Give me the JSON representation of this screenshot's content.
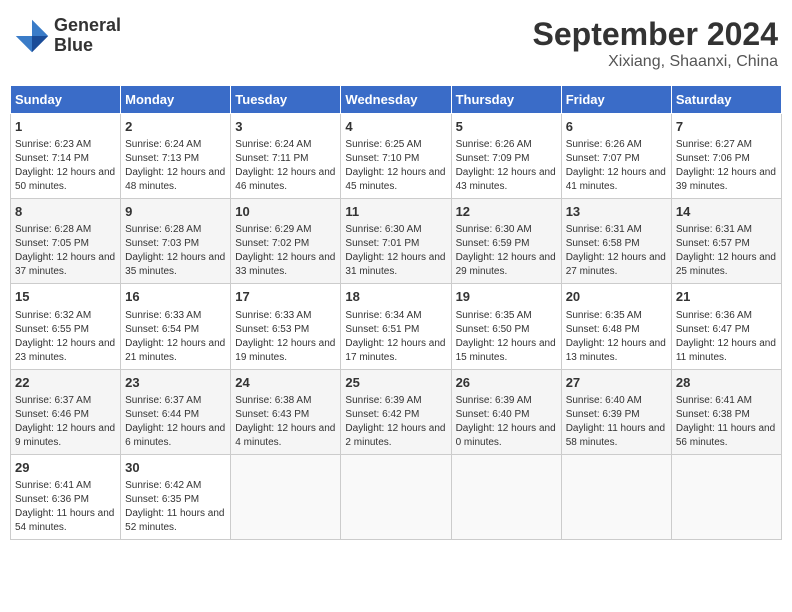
{
  "header": {
    "logo_line1": "General",
    "logo_line2": "Blue",
    "title": "September 2024",
    "subtitle": "Xixiang, Shaanxi, China"
  },
  "weekdays": [
    "Sunday",
    "Monday",
    "Tuesday",
    "Wednesday",
    "Thursday",
    "Friday",
    "Saturday"
  ],
  "weeks": [
    [
      {
        "day": "1",
        "sunrise": "6:23 AM",
        "sunset": "7:14 PM",
        "daylight": "12 hours and 50 minutes."
      },
      {
        "day": "2",
        "sunrise": "6:24 AM",
        "sunset": "7:13 PM",
        "daylight": "12 hours and 48 minutes."
      },
      {
        "day": "3",
        "sunrise": "6:24 AM",
        "sunset": "7:11 PM",
        "daylight": "12 hours and 46 minutes."
      },
      {
        "day": "4",
        "sunrise": "6:25 AM",
        "sunset": "7:10 PM",
        "daylight": "12 hours and 45 minutes."
      },
      {
        "day": "5",
        "sunrise": "6:26 AM",
        "sunset": "7:09 PM",
        "daylight": "12 hours and 43 minutes."
      },
      {
        "day": "6",
        "sunrise": "6:26 AM",
        "sunset": "7:07 PM",
        "daylight": "12 hours and 41 minutes."
      },
      {
        "day": "7",
        "sunrise": "6:27 AM",
        "sunset": "7:06 PM",
        "daylight": "12 hours and 39 minutes."
      }
    ],
    [
      {
        "day": "8",
        "sunrise": "6:28 AM",
        "sunset": "7:05 PM",
        "daylight": "12 hours and 37 minutes."
      },
      {
        "day": "9",
        "sunrise": "6:28 AM",
        "sunset": "7:03 PM",
        "daylight": "12 hours and 35 minutes."
      },
      {
        "day": "10",
        "sunrise": "6:29 AM",
        "sunset": "7:02 PM",
        "daylight": "12 hours and 33 minutes."
      },
      {
        "day": "11",
        "sunrise": "6:30 AM",
        "sunset": "7:01 PM",
        "daylight": "12 hours and 31 minutes."
      },
      {
        "day": "12",
        "sunrise": "6:30 AM",
        "sunset": "6:59 PM",
        "daylight": "12 hours and 29 minutes."
      },
      {
        "day": "13",
        "sunrise": "6:31 AM",
        "sunset": "6:58 PM",
        "daylight": "12 hours and 27 minutes."
      },
      {
        "day": "14",
        "sunrise": "6:31 AM",
        "sunset": "6:57 PM",
        "daylight": "12 hours and 25 minutes."
      }
    ],
    [
      {
        "day": "15",
        "sunrise": "6:32 AM",
        "sunset": "6:55 PM",
        "daylight": "12 hours and 23 minutes."
      },
      {
        "day": "16",
        "sunrise": "6:33 AM",
        "sunset": "6:54 PM",
        "daylight": "12 hours and 21 minutes."
      },
      {
        "day": "17",
        "sunrise": "6:33 AM",
        "sunset": "6:53 PM",
        "daylight": "12 hours and 19 minutes."
      },
      {
        "day": "18",
        "sunrise": "6:34 AM",
        "sunset": "6:51 PM",
        "daylight": "12 hours and 17 minutes."
      },
      {
        "day": "19",
        "sunrise": "6:35 AM",
        "sunset": "6:50 PM",
        "daylight": "12 hours and 15 minutes."
      },
      {
        "day": "20",
        "sunrise": "6:35 AM",
        "sunset": "6:48 PM",
        "daylight": "12 hours and 13 minutes."
      },
      {
        "day": "21",
        "sunrise": "6:36 AM",
        "sunset": "6:47 PM",
        "daylight": "12 hours and 11 minutes."
      }
    ],
    [
      {
        "day": "22",
        "sunrise": "6:37 AM",
        "sunset": "6:46 PM",
        "daylight": "12 hours and 9 minutes."
      },
      {
        "day": "23",
        "sunrise": "6:37 AM",
        "sunset": "6:44 PM",
        "daylight": "12 hours and 6 minutes."
      },
      {
        "day": "24",
        "sunrise": "6:38 AM",
        "sunset": "6:43 PM",
        "daylight": "12 hours and 4 minutes."
      },
      {
        "day": "25",
        "sunrise": "6:39 AM",
        "sunset": "6:42 PM",
        "daylight": "12 hours and 2 minutes."
      },
      {
        "day": "26",
        "sunrise": "6:39 AM",
        "sunset": "6:40 PM",
        "daylight": "12 hours and 0 minutes."
      },
      {
        "day": "27",
        "sunrise": "6:40 AM",
        "sunset": "6:39 PM",
        "daylight": "11 hours and 58 minutes."
      },
      {
        "day": "28",
        "sunrise": "6:41 AM",
        "sunset": "6:38 PM",
        "daylight": "11 hours and 56 minutes."
      }
    ],
    [
      {
        "day": "29",
        "sunrise": "6:41 AM",
        "sunset": "6:36 PM",
        "daylight": "11 hours and 54 minutes."
      },
      {
        "day": "30",
        "sunrise": "6:42 AM",
        "sunset": "6:35 PM",
        "daylight": "11 hours and 52 minutes."
      },
      null,
      null,
      null,
      null,
      null
    ]
  ]
}
